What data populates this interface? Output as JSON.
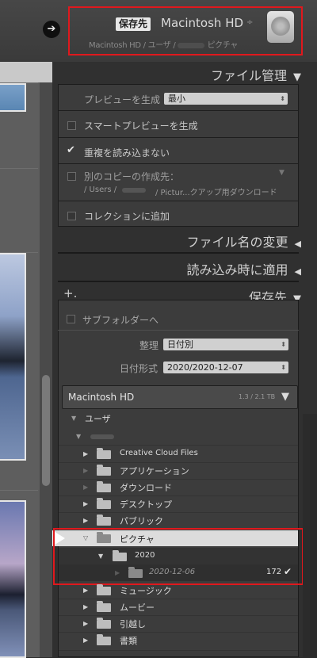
{
  "destination_bar": {
    "chip": "保存先",
    "title": "Macintosh HD",
    "updown_icon": "÷",
    "path_prefix": "Macintosh HD / ユーザ /",
    "path_suffix": "ピクチャ",
    "back_icon": "➔"
  },
  "file_handling": {
    "title": "ファイル管理",
    "preview_label": "プレビューを生成",
    "preview_value": "最小",
    "smart_preview": "スマートプレビューを生成",
    "no_duplicates": "重複を読み込まない",
    "copy_to_label": "別のコピーの作成先：",
    "copy_to_path_a": "/ Users /",
    "copy_to_path_b": "/ Pictur...クアップ用ダウンロード",
    "add_collection": "コレクションに追加"
  },
  "sections": {
    "file_rename": "ファイル名の変更",
    "apply_during_import": "読み込み時に適用",
    "destination": "保存先"
  },
  "destination": {
    "plus": "+.",
    "subfolder": "サブフォルダーへ",
    "organize_label": "整理",
    "organize_value": "日付別",
    "date_format_label": "日付形式",
    "date_format_value": "2020/2020-12-07",
    "volume_name": "Macintosh HD",
    "volume_space": "1.3 / 2.1 TB"
  },
  "tree": {
    "users": "ユーザ",
    "items": [
      {
        "label": "Creative Cloud Files"
      },
      {
        "label": "アプリケーション"
      },
      {
        "label": "ダウンロード"
      },
      {
        "label": "デスクトップ"
      },
      {
        "label": "パブリック"
      }
    ],
    "pictures": "ピクチャ",
    "year": "2020",
    "date": "2020-12-06",
    "date_count": "172",
    "after": [
      {
        "label": "ミュージック"
      },
      {
        "label": "ムービー"
      },
      {
        "label": "引越し"
      },
      {
        "label": "書類"
      }
    ]
  },
  "icons": {
    "triangle_down": "▼",
    "triangle_left": "◀",
    "check": "✔"
  },
  "colors": {
    "highlight_red": "#e0181d"
  }
}
